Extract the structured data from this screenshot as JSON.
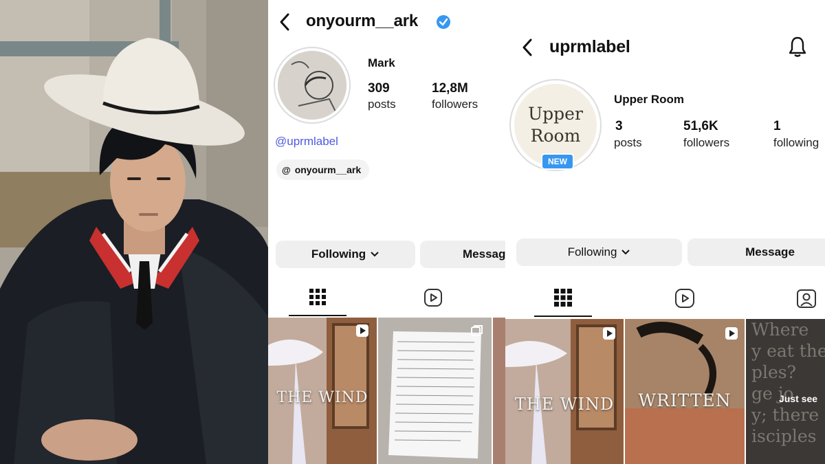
{
  "profile1": {
    "username": "onyourm__ark",
    "verified": true,
    "display_name": "Mark",
    "posts_count": "309",
    "posts_label": "posts",
    "followers_count": "12,8M",
    "followers_label": "followers",
    "linked_account": "@uprmlabel",
    "threads_handle": "onyourm__ark",
    "following_button": "Following",
    "message_button": "Message",
    "tiles": [
      {
        "overlay_text": "THE WIND",
        "badge": "reel-icon"
      },
      {
        "overlay_text": "",
        "badge": "carousel-icon"
      }
    ]
  },
  "profile2": {
    "username": "uprmlabel",
    "display_name": "Upper Room",
    "avatar_text_line1": "Upper",
    "avatar_text_line2": "Room",
    "new_badge": "NEW",
    "posts_count": "3",
    "posts_label": "posts",
    "followers_count": "51,6K",
    "followers_label": "followers",
    "following_count": "1",
    "following_label": "following",
    "following_button": "Following",
    "message_button": "Message",
    "tiles": [
      {
        "overlay_text": "THE WIND",
        "badge": "reel-icon"
      },
      {
        "overlay_text": "WRITTEN",
        "badge": "reel-icon"
      },
      {
        "overlay_text": "Just see",
        "background_text": [
          "Where",
          "y eat the",
          "ples?",
          "ge jo",
          "y; there",
          "isciples"
        ]
      }
    ]
  },
  "colors": {
    "verified_blue": "#3797f0",
    "link_blue": "#4d5ae0",
    "button_bg": "#efefef",
    "new_badge_bg": "#3797f0"
  }
}
